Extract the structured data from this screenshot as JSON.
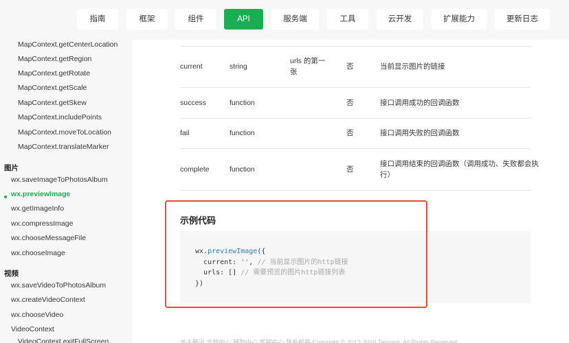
{
  "nav": {
    "items": [
      "指南",
      "框架",
      "组件",
      "API",
      "服务端",
      "工具",
      "云开发",
      "扩展能力",
      "更新日志"
    ],
    "active": "API"
  },
  "sidebar": {
    "items": [
      {
        "label": "MapContext.getCenterLocation",
        "level": "sub"
      },
      {
        "label": "MapContext.getRegion",
        "level": "sub"
      },
      {
        "label": "MapContext.getRotate",
        "level": "sub"
      },
      {
        "label": "MapContext.getScale",
        "level": "sub"
      },
      {
        "label": "MapContext.getSkew",
        "level": "sub"
      },
      {
        "label": "MapContext.includePoints",
        "level": "sub"
      },
      {
        "label": "MapContext.moveToLocation",
        "level": "sub"
      },
      {
        "label": "MapContext.translateMarker",
        "level": "sub"
      },
      {
        "label": "图片",
        "level": "cat"
      },
      {
        "label": "wx.saveImageToPhotosAlbum",
        "level": "lvl"
      },
      {
        "label": "wx.previewImage",
        "level": "lvl",
        "active": true
      },
      {
        "label": "wx.getImageInfo",
        "level": "lvl"
      },
      {
        "label": "wx.compressImage",
        "level": "lvl"
      },
      {
        "label": "wx.chooseMessageFile",
        "level": "lvl"
      },
      {
        "label": "wx.chooseImage",
        "level": "lvl"
      },
      {
        "label": "视频",
        "level": "cat"
      },
      {
        "label": "wx.saveVideoToPhotosAlbum",
        "level": "lvl"
      },
      {
        "label": "wx.createVideoContext",
        "level": "lvl"
      },
      {
        "label": "wx.chooseVideo",
        "level": "lvl"
      },
      {
        "label": "VideoContext",
        "level": "lvl"
      },
      {
        "label": "VideoContext.exitFullScreen",
        "level": "sub"
      }
    ]
  },
  "params_table": {
    "rows": [
      {
        "name": "current",
        "type": "string",
        "default_line1": "urls 的第一",
        "default_line2": "张",
        "required": "否",
        "desc_line1": "当前显示图片的链接",
        "desc_line2": ""
      },
      {
        "name": "success",
        "type": "function",
        "default_line1": "",
        "default_line2": "",
        "required": "否",
        "desc_line1": "接口调用成功的回调函数",
        "desc_line2": ""
      },
      {
        "name": "fail",
        "type": "function",
        "default_line1": "",
        "default_line2": "",
        "required": "否",
        "desc_line1": "接口调用失败的回调函数",
        "desc_line2": ""
      },
      {
        "name": "complete",
        "type": "function",
        "default_line1": "",
        "default_line2": "",
        "required": "否",
        "desc_line1": "接口调用结束的回调函数（调用成功、失败都会执",
        "desc_line2": "行）"
      }
    ]
  },
  "example": {
    "title": "示例代码",
    "code": {
      "l1_obj": "wx.",
      "l1_fn": "previewImage",
      "l1_end": "({",
      "l2_key": "  current: ",
      "l2_str": "''",
      "l2_sep": ", ",
      "l2_com": "// 当前显示图片的http链接",
      "l3_key": "  urls: [] ",
      "l3_com": "// 需要预览的图片http链接列表",
      "l4": "})"
    }
  },
  "footer": {
    "text": "关于腾讯   文档中心   辅助中心   客服中心   联系邮箱   Copyright © 2012-2019 Tencent. All Rights Reserved."
  }
}
